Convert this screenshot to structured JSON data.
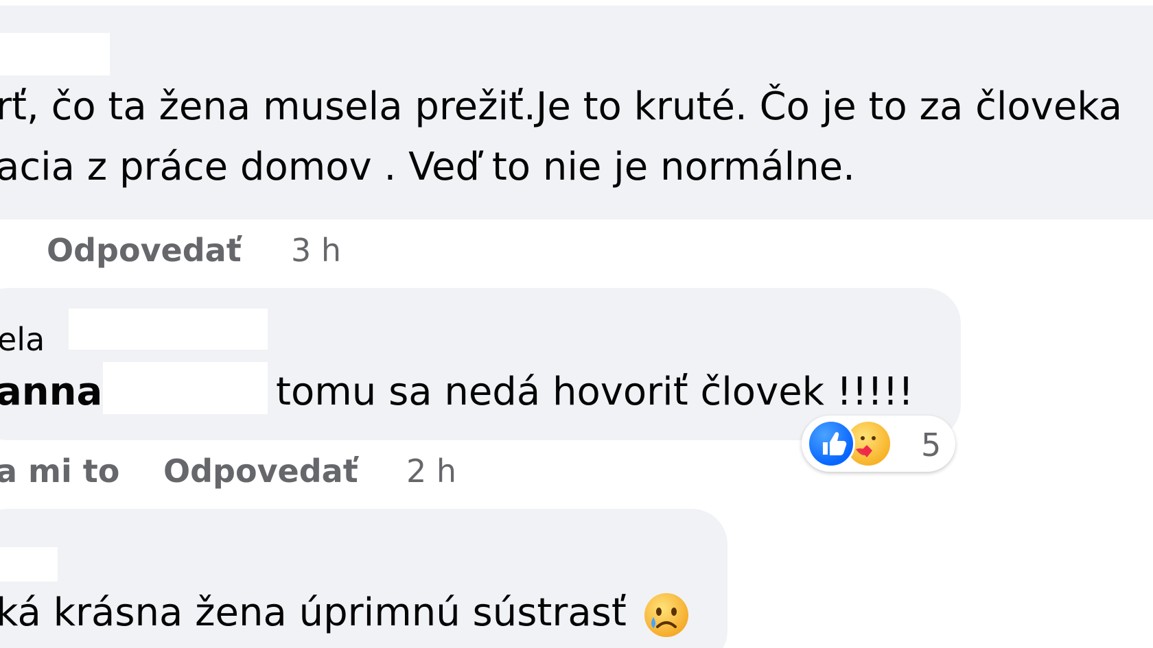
{
  "colors": {
    "bubble_bg": "#f0f2f5",
    "text": "#050505",
    "secondary_text": "#65676b",
    "like_blue": "#0866ff",
    "care_yellow": "#f7b125"
  },
  "comments": [
    {
      "lines": [
        "rť, čo ta žena musela prežiť.Je to kruté. Čo je to za človeka",
        "acia z práce domov . Veď to nie je normálne."
      ],
      "reply_label": "Odpovedať",
      "time": "3 h"
    },
    {
      "author_fragment": "ela",
      "mention_fragment": "anna",
      "text": "tomu sa nedá hovoriť človek !!!!!",
      "like_label": "a mi to",
      "reply_label": "Odpovedať",
      "time": "2 h",
      "reactions": {
        "icons": [
          "like-icon",
          "care-icon"
        ],
        "count": "5"
      }
    },
    {
      "text": "ká krásna žena úprimnú sústrasť",
      "emoji": "crying-face-icon"
    }
  ]
}
